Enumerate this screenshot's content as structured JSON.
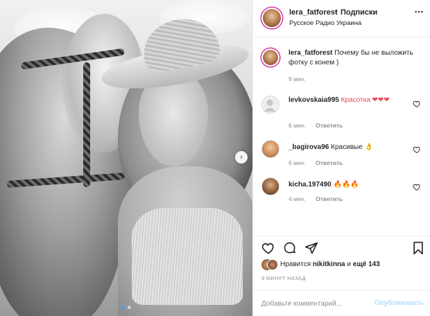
{
  "post": {
    "author": "lera_fatforest",
    "follow_label": "Подписки",
    "location": "Русское Радио Украина",
    "caption": "Почему бы не выложить фотку с конем )",
    "caption_time": "9 мин."
  },
  "comments": [
    {
      "user": "levkovskaia995",
      "text": "Красотка ❤❤❤",
      "time": "6 мин.",
      "reply_label": "Ответить"
    },
    {
      "user": "_bagirova96",
      "text": "Красивые 👌",
      "time": "6 мин.",
      "reply_label": "Ответить"
    },
    {
      "user": "kicha.197490",
      "text": "🔥🔥🔥",
      "time": "4 мин.",
      "reply_label": "Ответить"
    }
  ],
  "likes": {
    "prefix": "Нравится",
    "user": "nikitkinna",
    "and": "и",
    "rest": "ещё 143"
  },
  "posted_ago": "9 минут назад",
  "comment_input": {
    "placeholder": "Добавьте комментарий...",
    "publish_label": "Опубликовать"
  },
  "carousel": {
    "slide_count": 2,
    "active_index": 0
  },
  "icons": {
    "next": "chevron-right-icon",
    "more": "more-horizontal-icon",
    "like": "heart-icon",
    "comment": "comment-icon",
    "share": "share-icon",
    "save": "bookmark-icon"
  },
  "colors": {
    "text": "#262626",
    "secondary": "#8e8e8e",
    "publish_disabled": "#b2dffc",
    "heart_red": "#ed4956"
  }
}
